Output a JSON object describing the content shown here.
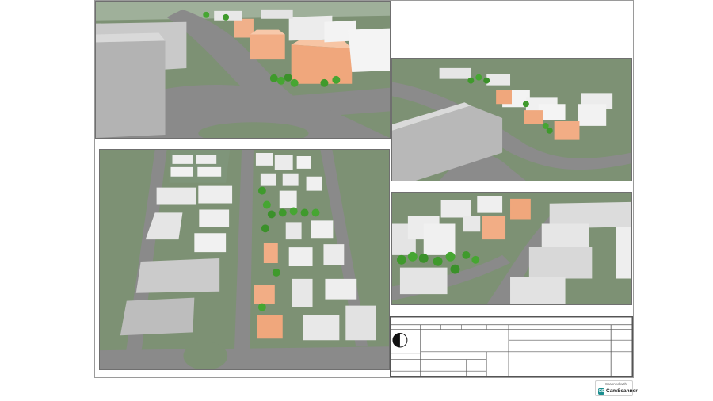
{
  "palette": {
    "grass": "#7b9174",
    "road": "#848484",
    "white_building": "#efefef",
    "orange_building": "#f2ad85",
    "tree": "#3f9a2c"
  },
  "scanner": {
    "line1": "Scanned with",
    "icon": "CS",
    "line2": "CamScanner"
  }
}
